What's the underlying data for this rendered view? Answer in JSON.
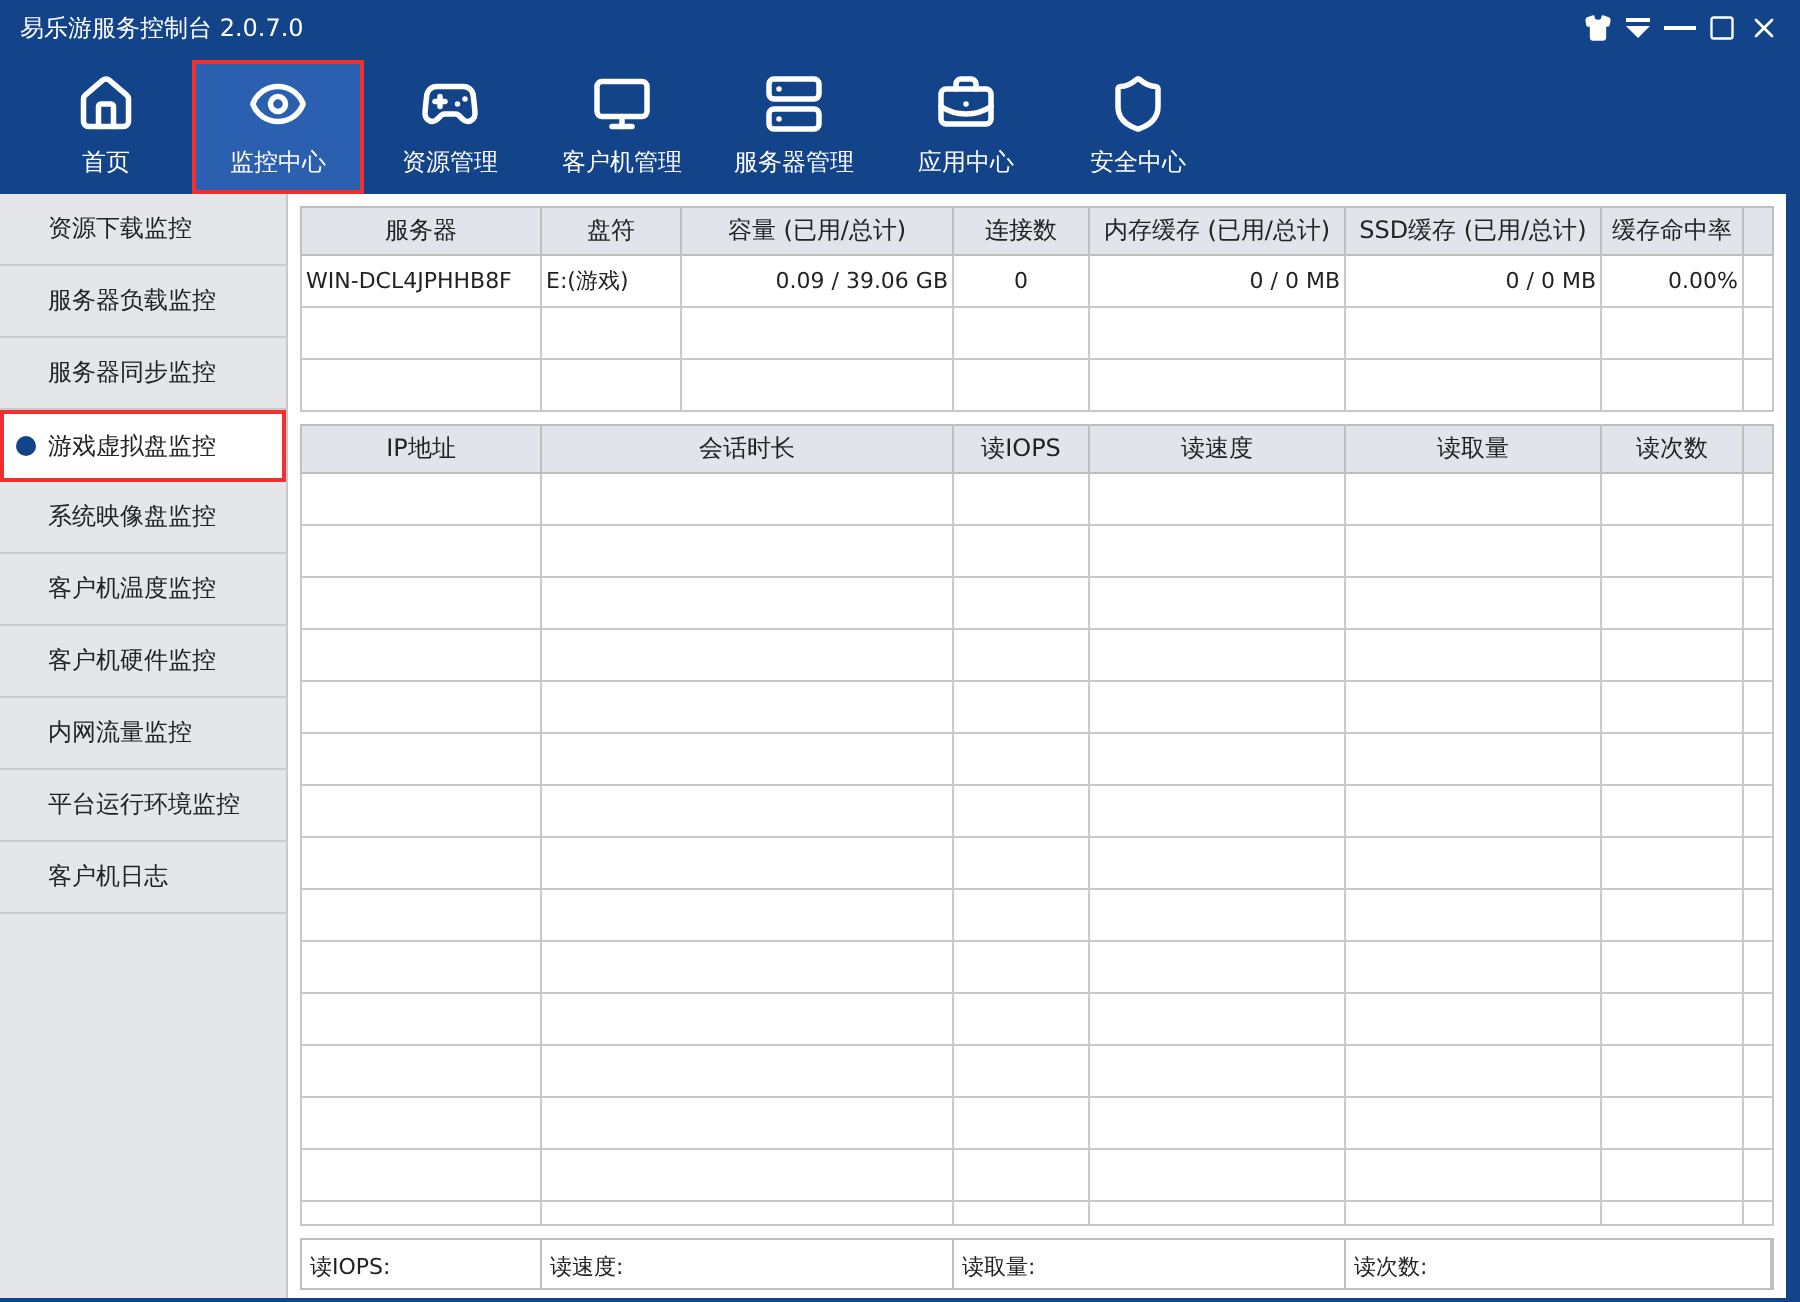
{
  "window": {
    "title": "易乐游服务控制台 2.0.7.0"
  },
  "nav": [
    {
      "label": "首页",
      "kind": "home",
      "selected": false
    },
    {
      "label": "监控中心",
      "kind": "eye",
      "selected": true
    },
    {
      "label": "资源管理",
      "kind": "gamepad",
      "selected": false
    },
    {
      "label": "客户机管理",
      "kind": "monitor",
      "selected": false
    },
    {
      "label": "服务器管理",
      "kind": "server",
      "selected": false
    },
    {
      "label": "应用中心",
      "kind": "toolbox",
      "selected": false
    },
    {
      "label": "安全中心",
      "kind": "shield",
      "selected": false
    }
  ],
  "sidebar": [
    {
      "label": "资源下载监控",
      "selected": false
    },
    {
      "label": "服务器负载监控",
      "selected": false
    },
    {
      "label": "服务器同步监控",
      "selected": false
    },
    {
      "label": "游戏虚拟盘监控",
      "selected": true
    },
    {
      "label": "系统映像盘监控",
      "selected": false
    },
    {
      "label": "客户机温度监控",
      "selected": false
    },
    {
      "label": "客户机硬件监控",
      "selected": false
    },
    {
      "label": "内网流量监控",
      "selected": false
    },
    {
      "label": "平台运行环境监控",
      "selected": false
    },
    {
      "label": "客户机日志",
      "selected": false
    }
  ],
  "server_table": {
    "columns": [
      "服务器",
      "盘符",
      "容量 (已用/总计)",
      "连接数",
      "内存缓存 (已用/总计)",
      "SSD缓存 (已用/总计)",
      "缓存命中率"
    ],
    "rows": [
      [
        "WIN-DCL4JPHHB8F",
        "E:(游戏)",
        "0.09 / 39.06 GB",
        "0",
        "0 / 0 MB",
        "0 / 0 MB",
        "0.00%"
      ]
    ]
  },
  "session_table": {
    "columns": [
      "IP地址",
      "会话时长",
      "读IOPS",
      "读速度",
      "读取量",
      "读次数"
    ]
  },
  "footer": [
    "读IOPS:",
    "读速度:",
    "读取量:",
    "读次数:"
  ]
}
